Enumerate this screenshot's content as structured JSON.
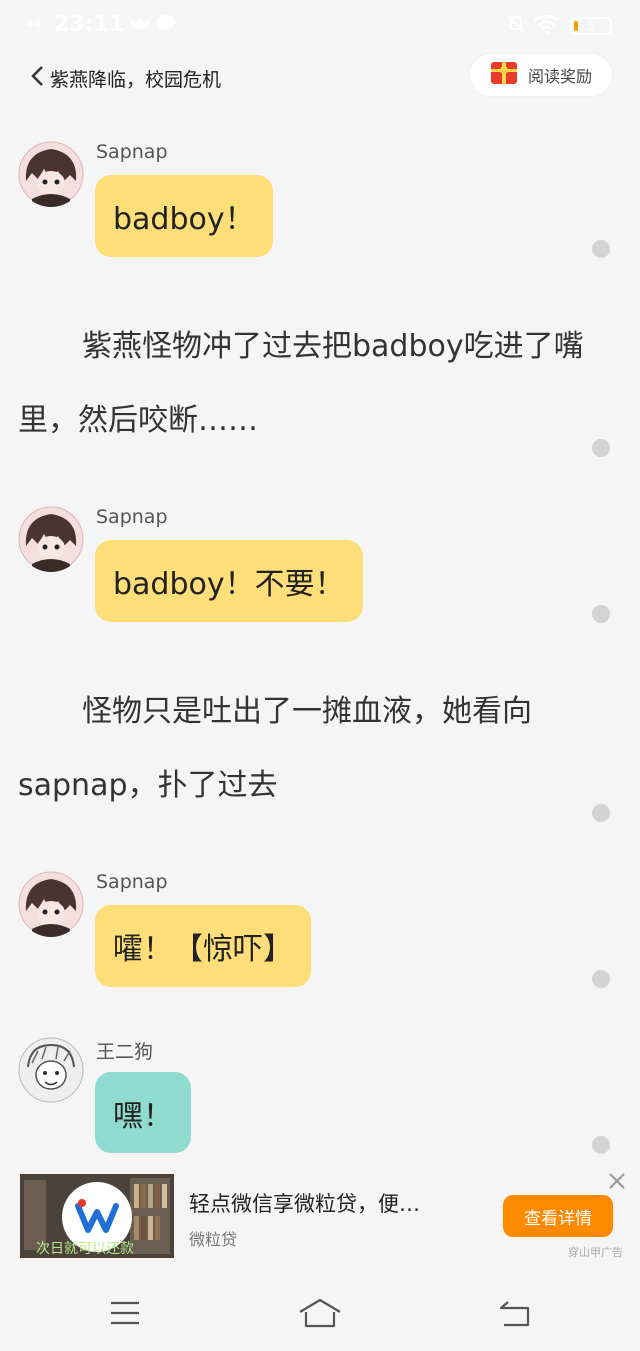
{
  "status_bar": {
    "network": "4G",
    "time": "23:11",
    "battery": "5"
  },
  "header": {
    "title": "紫燕降临，校园危机",
    "reward_label": "阅读奖励"
  },
  "messages": [
    {
      "sender": "Sapnap",
      "text": "badboy！",
      "avatar": "avatar-sapnap",
      "bubble_color": "#fede79"
    },
    {
      "sender": "Sapnap",
      "text": "badboy！不要！",
      "avatar": "avatar-sapnap",
      "bubble_color": "#fede79"
    },
    {
      "sender": "Sapnap",
      "text": "嚯！【惊吓】",
      "avatar": "avatar-sapnap",
      "bubble_color": "#fede79"
    },
    {
      "sender": "王二狗",
      "text": "嘿！",
      "avatar": "avatar-wangergou",
      "bubble_color": "#8fdbcf"
    }
  ],
  "narrations": [
    "紫燕怪物冲了过去把badboy吃进了嘴里，然后咬断……",
    "怪物只是吐出了一摊血液，她看向sapnap，扑了过去"
  ],
  "ad": {
    "title": "轻点微信享微粒贷，便…",
    "subtitle": "微粒贷",
    "image_caption": "次日就可以还款",
    "cta": "查看详情",
    "source": "穿山甲广告"
  },
  "colors": {
    "background": "#f5f5f5",
    "bubble_yellow": "#fede79",
    "bubble_teal": "#8fdbcf",
    "cta": "#ff8a00"
  }
}
